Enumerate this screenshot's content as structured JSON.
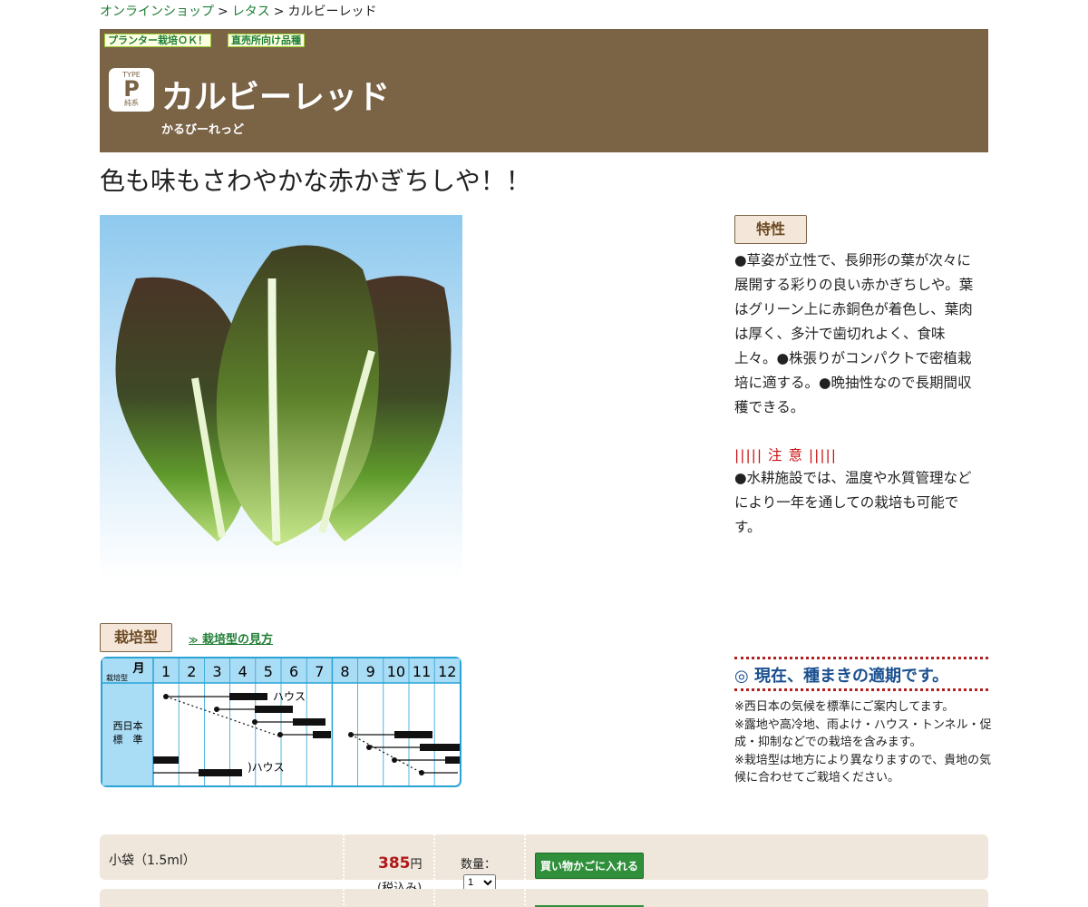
{
  "breadcrumb": {
    "shop": "オンラインショップ",
    "category": "レタス",
    "current": "カルビーレッド",
    "sep": ">"
  },
  "hero": {
    "badge_planter": "プランター栽培ＯＫ！",
    "badge_direct": "直売所向け品種",
    "type_top": "TYPE",
    "type_letter": "P",
    "type_bottom": "純系",
    "title": "カルビーレッド",
    "reading": "かるびーれっど"
  },
  "catch_copy": "色も味もさわやかな赤かぎちしや！！",
  "features": {
    "label": "特性",
    "text": "●草姿が立性で、長卵形の葉が次々に展開する彩りの良い赤かぎちしや。葉はグリーン上に赤銅色が着色し、葉肉は厚く、多汁で歯切れよく、食味上々。●株張りがコンパクトで密植栽培に適する。●晩抽性なので長期間収穫できる。"
  },
  "caution": {
    "title": "||||| 注 意 |||||",
    "text": "●水耕施設では、温度や水質管理などにより一年を通しての栽培も可能です。"
  },
  "cultivation": {
    "label": "栽培型",
    "guide_link": "栽培型の見方",
    "guide_arrow": "≫",
    "corner_month": "月",
    "corner_type": "栽培型",
    "months": [
      "1",
      "2",
      "3",
      "4",
      "5",
      "6",
      "7",
      "8",
      "9",
      "10",
      "11",
      "12"
    ],
    "region": "西日本\n標　準",
    "house_label_1": "ハウス",
    "house_label_2": ")ハウス"
  },
  "season": {
    "status": "◎ 現在、種まきの適期です。",
    "notes": [
      "※西日本の気候を標準にご案内してます。",
      "※露地や高冷地、雨よけ・ハウス・トンネル・促成・抑制などでの栽培を含みます。",
      "※栽培型は地方により異なりますので、貴地の気候に合わせてご栽培ください。"
    ]
  },
  "order": {
    "size": "小袋（1.5ml）",
    "price": "385",
    "price_unit": "円",
    "tax_note": "(税込み)",
    "qty_label": "数量：",
    "qty_value": "1",
    "cart_label": "買い物かごに入れる"
  },
  "colors": {
    "hero_bg": "#7b6446",
    "accent_green": "#1e7e34",
    "price_red": "#b01818",
    "season_blue": "#1a4f8f"
  }
}
